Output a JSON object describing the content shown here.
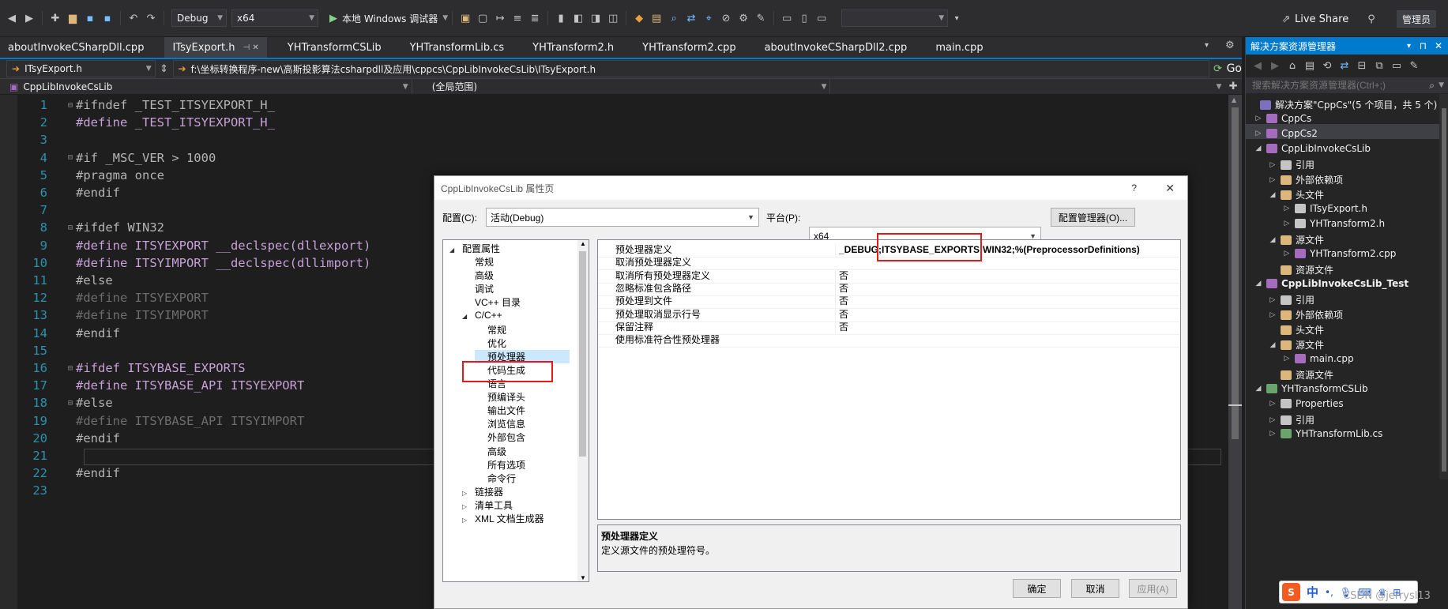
{
  "toolbar": {
    "config": "Debug",
    "platform": "x64",
    "run_label": "本地 Windows 调试器",
    "live_share": "Live Share",
    "admin": "管理员"
  },
  "tabs": [
    {
      "label": "aboutInvokeCSharpDll.cpp",
      "active": false
    },
    {
      "label": "ITsyExport.h",
      "active": true
    },
    {
      "label": "YHTransformCSLib",
      "active": false
    },
    {
      "label": "YHTransformLib.cs",
      "active": false
    },
    {
      "label": "YHTransform2.h",
      "active": false
    },
    {
      "label": "YHTransform2.cpp",
      "active": false
    },
    {
      "label": "aboutInvokeCSharpDll2.cpp",
      "active": false
    },
    {
      "label": "main.cpp",
      "active": false
    }
  ],
  "nav": {
    "file": "ITsyExport.h",
    "path": "f:\\坐标转换程序-new\\高斯投影算法csharpdll及应用\\cppcs\\CppLibInvokeCsLib\\ITsyExport.h",
    "go": "Go",
    "project": "CppLibInvokeCsLib",
    "scope": "(全局范围)"
  },
  "code": [
    {
      "n": "1",
      "t": "#ifndef _TEST_ITSYEXPORT_H_"
    },
    {
      "n": "2",
      "t": "#define _TEST_ITSYEXPORT_H_"
    },
    {
      "n": "3",
      "t": ""
    },
    {
      "n": "4",
      "t": "#if _MSC_VER > 1000"
    },
    {
      "n": "5",
      "t": "#pragma once"
    },
    {
      "n": "6",
      "t": "#endif"
    },
    {
      "n": "7",
      "t": ""
    },
    {
      "n": "8",
      "t": "#ifdef WIN32"
    },
    {
      "n": "9",
      "t": "#define ITSYEXPORT __declspec(dllexport)"
    },
    {
      "n": "10",
      "t": "#define ITSYIMPORT __declspec(dllimport)"
    },
    {
      "n": "11",
      "t": "#else"
    },
    {
      "n": "12",
      "t": "#define ITSYEXPORT"
    },
    {
      "n": "13",
      "t": "#define ITSYIMPORT"
    },
    {
      "n": "14",
      "t": "#endif"
    },
    {
      "n": "15",
      "t": ""
    },
    {
      "n": "16",
      "t": "#ifdef ITSYBASE_EXPORTS"
    },
    {
      "n": "17",
      "t": "#define ITSYBASE_API ITSYEXPORT"
    },
    {
      "n": "18",
      "t": "#else"
    },
    {
      "n": "19",
      "t": "#define ITSYBASE_API ITSYIMPORT"
    },
    {
      "n": "20",
      "t": "#endif"
    },
    {
      "n": "21",
      "t": ""
    },
    {
      "n": "22",
      "t": "#endif"
    },
    {
      "n": "23",
      "t": ""
    }
  ],
  "dialog": {
    "title": "CppLibInvokeCsLib 属性页",
    "help": "?",
    "close": "✕",
    "config_label": "配置(C):",
    "config_value": "活动(Debug)",
    "platform_label": "平台(P):",
    "platform_value": "x64",
    "config_mgr": "配置管理器(O)...",
    "tree": [
      {
        "label": "配置属性",
        "exp": "◢"
      },
      {
        "label": "常规",
        "exp": ""
      },
      {
        "label": "高级",
        "exp": ""
      },
      {
        "label": "调试",
        "exp": ""
      },
      {
        "label": "VC++ 目录",
        "exp": ""
      },
      {
        "label": "C/C++",
        "exp": "◢"
      },
      {
        "label": "常规",
        "exp": ""
      },
      {
        "label": "优化",
        "exp": ""
      },
      {
        "label": "预处理器",
        "exp": ""
      },
      {
        "label": "代码生成",
        "exp": ""
      },
      {
        "label": "语言",
        "exp": ""
      },
      {
        "label": "预编译头",
        "exp": ""
      },
      {
        "label": "输出文件",
        "exp": ""
      },
      {
        "label": "浏览信息",
        "exp": ""
      },
      {
        "label": "外部包含",
        "exp": ""
      },
      {
        "label": "高级",
        "exp": ""
      },
      {
        "label": "所有选项",
        "exp": ""
      },
      {
        "label": "命令行",
        "exp": ""
      },
      {
        "label": "链接器",
        "exp": "▷"
      },
      {
        "label": "清单工具",
        "exp": "▷"
      },
      {
        "label": "XML 文档生成器",
        "exp": "▷"
      }
    ],
    "props": [
      {
        "name": "预处理器定义",
        "value": "_DEBUG;ITSYBASE_EXPORTS;WIN32;%(PreprocessorDefinitions)"
      },
      {
        "name": "取消预处理器定义",
        "value": ""
      },
      {
        "name": "取消所有预处理器定义",
        "value": "否"
      },
      {
        "name": "忽略标准包含路径",
        "value": "否"
      },
      {
        "name": "预处理到文件",
        "value": "否"
      },
      {
        "name": "预处理取消显示行号",
        "value": "否"
      },
      {
        "name": "保留注释",
        "value": "否"
      },
      {
        "name": "使用标准符合性预处理器",
        "value": ""
      }
    ],
    "desc_title": "预处理器定义",
    "desc_text": "定义源文件的预处理符号。",
    "ok": "确定",
    "cancel": "取消",
    "apply": "应用(A)"
  },
  "solution": {
    "header": "解决方案资源管理器",
    "search_placeholder": "搜索解决方案资源管理器(Ctrl+;)",
    "items": [
      {
        "label": "解决方案\"CppCs\"(5 个项目，共 5 个)",
        "exp": "",
        "icon": "solution-icon",
        "color": "#7e6fc1"
      },
      {
        "label": "CppCs",
        "exp": "▷",
        "icon": "cpp-project-icon",
        "color": "#a56bbd"
      },
      {
        "label": "CppCs2",
        "exp": "▷",
        "icon": "cpp-project-icon",
        "color": "#a56bbd"
      },
      {
        "label": "CppLibInvokeCsLib",
        "exp": "◢",
        "icon": "cpp-project-icon",
        "color": "#a56bbd"
      },
      {
        "label": "引用",
        "exp": "▷",
        "icon": "references-icon",
        "color": "#c5c5c5"
      },
      {
        "label": "外部依赖项",
        "exp": "▷",
        "icon": "folder-icon",
        "color": "#dcb67a"
      },
      {
        "label": "头文件",
        "exp": "◢",
        "icon": "folder-icon",
        "color": "#dcb67a"
      },
      {
        "label": "ITsyExport.h",
        "exp": "▷",
        "icon": "header-file-icon",
        "color": "#c5c5c5"
      },
      {
        "label": "YHTransform2.h",
        "exp": "▷",
        "icon": "header-file-icon",
        "color": "#c5c5c5"
      },
      {
        "label": "源文件",
        "exp": "◢",
        "icon": "folder-icon",
        "color": "#dcb67a"
      },
      {
        "label": "YHTransform2.cpp",
        "exp": "▷",
        "icon": "cpp-file-icon",
        "color": "#a56bbd"
      },
      {
        "label": "资源文件",
        "exp": "",
        "icon": "folder-icon",
        "color": "#dcb67a"
      },
      {
        "label": "CppLibInvokeCsLib_Test",
        "exp": "◢",
        "icon": "cpp-project-icon",
        "color": "#a56bbd"
      },
      {
        "label": "引用",
        "exp": "▷",
        "icon": "references-icon",
        "color": "#c5c5c5"
      },
      {
        "label": "外部依赖项",
        "exp": "▷",
        "icon": "folder-icon",
        "color": "#dcb67a"
      },
      {
        "label": "头文件",
        "exp": "",
        "icon": "folder-icon",
        "color": "#dcb67a"
      },
      {
        "label": "源文件",
        "exp": "◢",
        "icon": "folder-icon",
        "color": "#dcb67a"
      },
      {
        "label": "main.cpp",
        "exp": "▷",
        "icon": "cpp-file-icon",
        "color": "#a56bbd"
      },
      {
        "label": "资源文件",
        "exp": "",
        "icon": "folder-icon",
        "color": "#dcb67a"
      },
      {
        "label": "YHTransformCSLib",
        "exp": "◢",
        "icon": "cs-project-icon",
        "color": "#68a46c"
      },
      {
        "label": "Properties",
        "exp": "▷",
        "icon": "properties-icon",
        "color": "#c5c5c5"
      },
      {
        "label": "引用",
        "exp": "▷",
        "icon": "references-icon",
        "color": "#c5c5c5"
      },
      {
        "label": "YHTransformLib.cs",
        "exp": "▷",
        "icon": "cs-file-icon",
        "color": "#68a46c"
      }
    ]
  },
  "ime": {
    "label": "中",
    "extra": "•,"
  },
  "watermark": "CSDN @jerrysl13"
}
